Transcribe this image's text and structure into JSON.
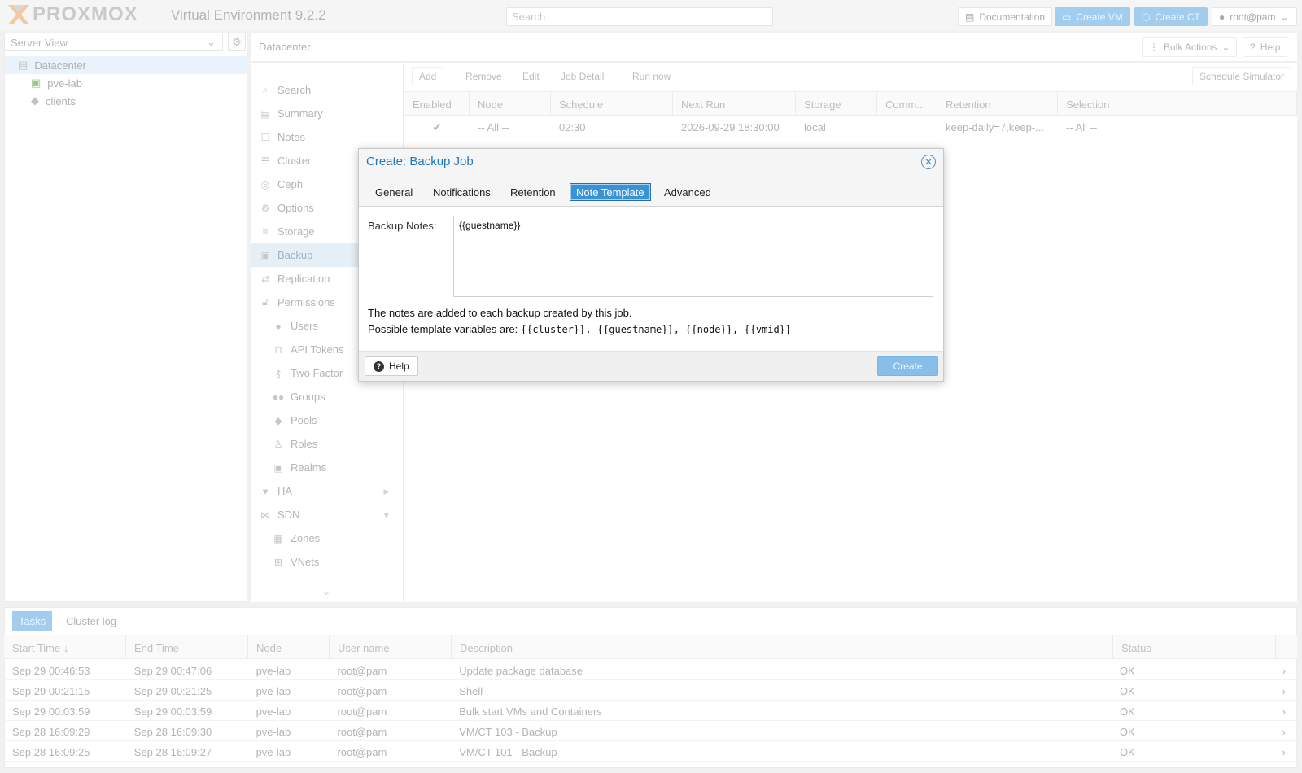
{
  "header": {
    "brand": "PROXMOX",
    "version": "Virtual Environment 9.2.2",
    "search_placeholder": "Search",
    "buttons": {
      "documentation": "Documentation",
      "create_vm": "Create VM",
      "create_ct": "Create CT",
      "user": "root@pam"
    }
  },
  "tree": {
    "view_selector": "Server View",
    "items": [
      {
        "label": "Datacenter"
      },
      {
        "label": "pve-lab"
      },
      {
        "label": "clients"
      }
    ]
  },
  "content": {
    "breadcrumb": "Datacenter",
    "bulk_actions": "Bulk Actions",
    "help": "Help"
  },
  "nav": {
    "items": [
      {
        "label": "Search",
        "icon": "search-icon"
      },
      {
        "label": "Summary",
        "icon": "book-icon"
      },
      {
        "label": "Notes",
        "icon": "notes-icon"
      },
      {
        "label": "Cluster",
        "icon": "server-icon"
      },
      {
        "label": "Ceph",
        "icon": "ceph-icon"
      },
      {
        "label": "Options",
        "icon": "gear-icon"
      },
      {
        "label": "Storage",
        "icon": "database-icon"
      },
      {
        "label": "Backup",
        "icon": "floppy-icon"
      },
      {
        "label": "Replication",
        "icon": "retweet-icon"
      },
      {
        "label": "Permissions",
        "icon": "unlock-icon"
      },
      {
        "label": "Users",
        "icon": "user-icon"
      },
      {
        "label": "API Tokens",
        "icon": "lock-icon"
      },
      {
        "label": "Two Factor",
        "icon": "key-icon"
      },
      {
        "label": "Groups",
        "icon": "users-icon"
      },
      {
        "label": "Pools",
        "icon": "tags-icon"
      },
      {
        "label": "Roles",
        "icon": "male-icon"
      },
      {
        "label": "Realms",
        "icon": "address-book-icon"
      },
      {
        "label": "HA",
        "icon": "heartbeat-icon"
      },
      {
        "label": "SDN",
        "icon": "sdn-icon"
      },
      {
        "label": "Zones",
        "icon": "grid-icon"
      },
      {
        "label": "VNets",
        "icon": "network-icon"
      }
    ]
  },
  "backup_toolbar": {
    "add": "Add",
    "remove": "Remove",
    "edit": "Edit",
    "job_detail": "Job Detail",
    "run_now": "Run now",
    "schedule_simulator": "Schedule Simulator"
  },
  "backup_grid": {
    "columns": [
      "Enabled",
      "Node",
      "Schedule",
      "Next Run",
      "Storage",
      "Comm...",
      "Retention",
      "Selection"
    ],
    "rows": [
      {
        "enabled": "✔",
        "node": "-- All --",
        "schedule": "02:30",
        "next_run": "2026-09-29 18:30:00",
        "storage": "local",
        "comment": "",
        "retention": "keep-daily=7,keep-...",
        "selection": "-- All --"
      }
    ]
  },
  "dialog": {
    "title": "Create: Backup Job",
    "tabs": [
      "General",
      "Notifications",
      "Retention",
      "Note Template",
      "Advanced"
    ],
    "active_tab": "Note Template",
    "notes_label": "Backup Notes:",
    "notes_value": "{{guestname}}",
    "info_line1": "The notes are added to each backup created by this job.",
    "info_line2_prefix": "Possible template variables are: ",
    "info_vars": "{{cluster}}, {{guestname}}, {{node}}, {{vmid}}",
    "help_button": "Help",
    "create_button": "Create"
  },
  "tasks": {
    "tabs": [
      "Tasks",
      "Cluster log"
    ],
    "columns": [
      "Start Time ↓",
      "End Time",
      "Node",
      "User name",
      "Description",
      "Status"
    ],
    "rows": [
      {
        "start": "Sep 29 00:46:53",
        "end": "Sep 29 00:47:06",
        "node": "pve-lab",
        "user": "root@pam",
        "desc": "Update package database",
        "status": "OK"
      },
      {
        "start": "Sep 29 00:21:15",
        "end": "Sep 29 00:21:25",
        "node": "pve-lab",
        "user": "root@pam",
        "desc": "Shell",
        "status": "OK"
      },
      {
        "start": "Sep 29 00:03:59",
        "end": "Sep 29 00:03:59",
        "node": "pve-lab",
        "user": "root@pam",
        "desc": "Bulk start VMs and Containers",
        "status": "OK"
      },
      {
        "start": "Sep 28 16:09:29",
        "end": "Sep 28 16:09:30",
        "node": "pve-lab",
        "user": "root@pam",
        "desc": "VM/CT 103 - Backup",
        "status": "OK"
      },
      {
        "start": "Sep 28 16:09:25",
        "end": "Sep 28 16:09:27",
        "node": "pve-lab",
        "user": "root@pam",
        "desc": "VM/CT 101 - Backup",
        "status": "OK"
      }
    ]
  }
}
